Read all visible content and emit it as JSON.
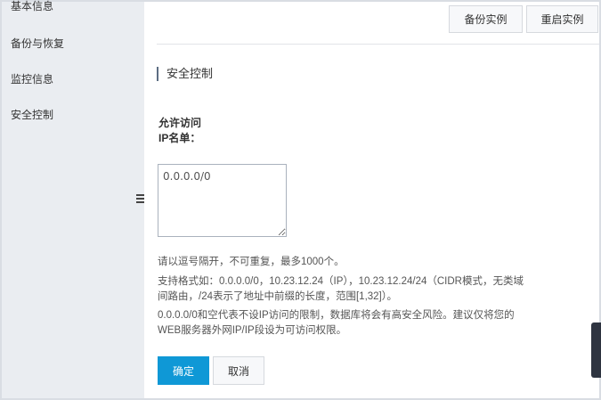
{
  "sidebar": {
    "items": [
      {
        "label": "基本信息"
      },
      {
        "label": "备份与恢复"
      },
      {
        "label": "监控信息"
      },
      {
        "label": "安全控制"
      }
    ]
  },
  "toolbar": {
    "backup_label": "备份实例",
    "restart_label": "重启实例"
  },
  "section": {
    "title": "安全控制"
  },
  "form": {
    "label_line1": "允许访问",
    "label_line2": "IP名单：",
    "ip_value": "0.0.0.0/0",
    "help1": "请以逗号隔开，不可重复，最多1000个。",
    "help2": "支持格式如：0.0.0.0/0，10.23.12.24（IP），10.23.12.24/24（CIDR模式，无类域间路由，/24表示了地址中前缀的长度，范围[1,32]）。",
    "help3": "0.0.0.0/0和空代表不设IP访问的限制，数据库将会有高安全风险。建议仅将您的WEB服务器外网IP/IP段设为可访问权限。",
    "ok_label": "确定",
    "cancel_label": "取消"
  }
}
